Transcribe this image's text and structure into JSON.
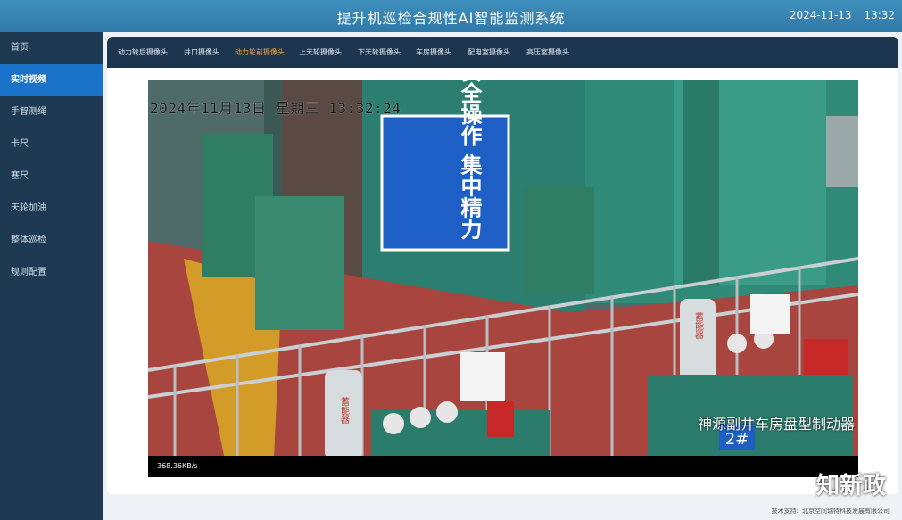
{
  "header": {
    "title": "提升机巡检合规性AI智能监测系统",
    "date": "2024-11-13",
    "time": "13:32"
  },
  "sidebar": {
    "items": [
      {
        "label": "首页"
      },
      {
        "label": "实时视频",
        "active": true
      },
      {
        "label": "手智测绳"
      },
      {
        "label": "卡尺"
      },
      {
        "label": "塞尺"
      },
      {
        "label": "天轮加油"
      },
      {
        "label": "整体巡检"
      },
      {
        "label": "规则配置"
      }
    ]
  },
  "tabs": [
    {
      "label": "动力轮后摄像头"
    },
    {
      "label": "井口摄像头"
    },
    {
      "label": "动力轮前摄像头",
      "active": true
    },
    {
      "label": "上天轮摄像头"
    },
    {
      "label": "下天轮摄像头"
    },
    {
      "label": "车房摄像头"
    },
    {
      "label": "配电室摄像头"
    },
    {
      "label": "高压室摄像头"
    }
  ],
  "video": {
    "osd_time": "2024年11月13日 星期三 13:32:24",
    "caption": "神源副井车房盘型制动器",
    "sign_text": [
      "安全操作",
      "集中精力"
    ],
    "tank_label": "蓄能器",
    "unit_label": "2#",
    "bitrate": "368.36KB/s"
  },
  "footer": {
    "label": "技术支持:",
    "company": "北京空间瑞特科技发展有限公司"
  },
  "watermark": "知新政",
  "colors": {
    "topbar": "#3485b5",
    "sidebar": "#1e3a52",
    "sidebar_active": "#1a73c8",
    "tabbar": "#1d3650",
    "tab_active": "#f0a640",
    "machine_teal": "#2f8a78",
    "sign_blue": "#1d5fc4"
  }
}
